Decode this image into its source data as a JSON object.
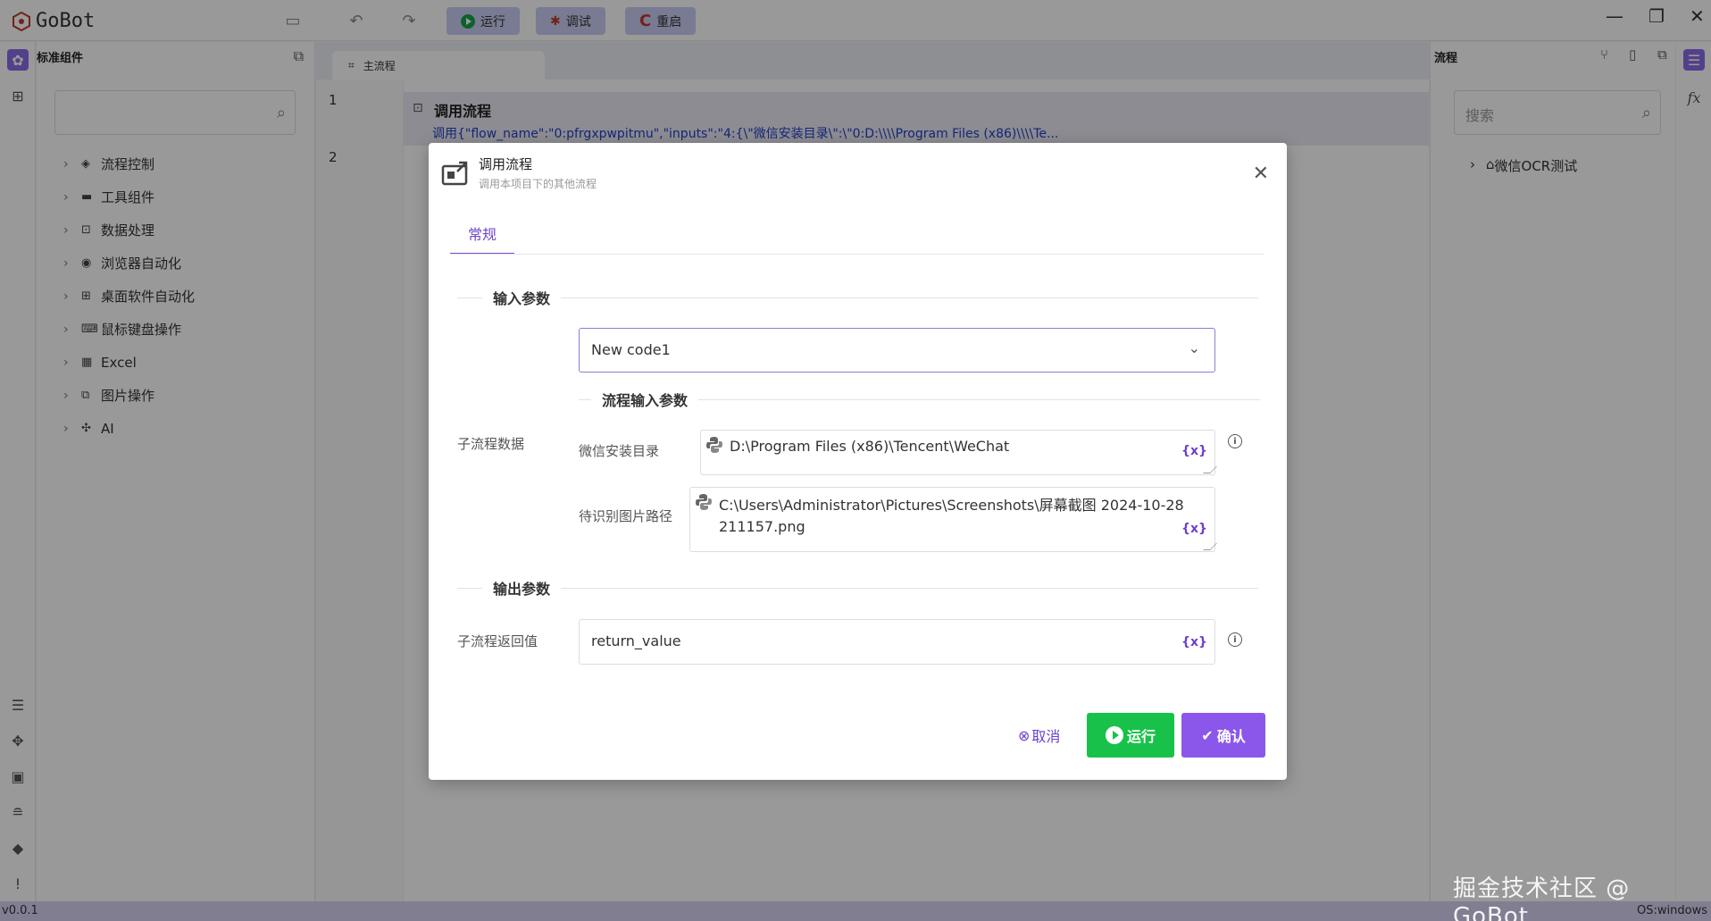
{
  "app": {
    "logo_text": "GoBot",
    "toolbar": {
      "run_label": "运行",
      "debug_label": "调试",
      "restart_label": "重启"
    }
  },
  "left_panel": {
    "title": "标准组件",
    "tree": [
      {
        "label": "流程控制",
        "icon": "diamond-icon"
      },
      {
        "label": "工具组件",
        "icon": "toolbox-icon"
      },
      {
        "label": "数据处理",
        "icon": "data-icon"
      },
      {
        "label": "浏览器自动化",
        "icon": "chrome-icon"
      },
      {
        "label": "桌面软件自动化",
        "icon": "windows-icon"
      },
      {
        "label": "鼠标键盘操作",
        "icon": "keyboard-icon"
      },
      {
        "label": "Excel",
        "icon": "excel-icon"
      },
      {
        "label": "图片操作",
        "icon": "image-icon"
      },
      {
        "label": "AI",
        "icon": "ai-icon"
      }
    ]
  },
  "editor": {
    "tab_label": "主流程",
    "line_numbers": [
      "1",
      "2"
    ],
    "step_title": "调用流程",
    "step_summary": "调用{\"flow_name\":\"0:pfrgxpwpitmu\",\"inputs\":\"4:{\\\"微信安装目录\\\":\\\"0:D:\\\\\\\\Program Files (x86)\\\\\\\\Te..."
  },
  "right_panel": {
    "title": "流程",
    "search_placeholder": "搜索",
    "tree_item": "微信OCR测试"
  },
  "dialog": {
    "title": "调用流程",
    "subtitle": "调用本项目下的其他流程",
    "tab": "常规",
    "input_section": "输入参数",
    "subflow_label": "子流程数据",
    "selected_flow": "New code1",
    "flow_input_section": "流程输入参数",
    "params": [
      {
        "label": "微信安装目录",
        "value": "D:\\Program Files (x86)\\Tencent\\WeChat"
      },
      {
        "label": "待识别图片路径",
        "value_line1": "C:\\Users\\Administrator\\Pictures\\Screenshots\\屏幕截图 2024-10-28",
        "value_line2": "211157.png"
      }
    ],
    "var_token": "{x}",
    "info_symbol": "i",
    "output_section": "输出参数",
    "return_label": "子流程返回值",
    "return_value": "return_value",
    "cancel_label": "取消",
    "run_label": "运行",
    "confirm_label": "确认"
  },
  "status": {
    "version": "v0.0.1",
    "os": "OS:windows"
  },
  "watermark": "掘金技术社区 @ GoBot",
  "colors": {
    "accent": "#8a57ea",
    "run_green": "#18c24a",
    "link_blue": "#2440c7"
  }
}
